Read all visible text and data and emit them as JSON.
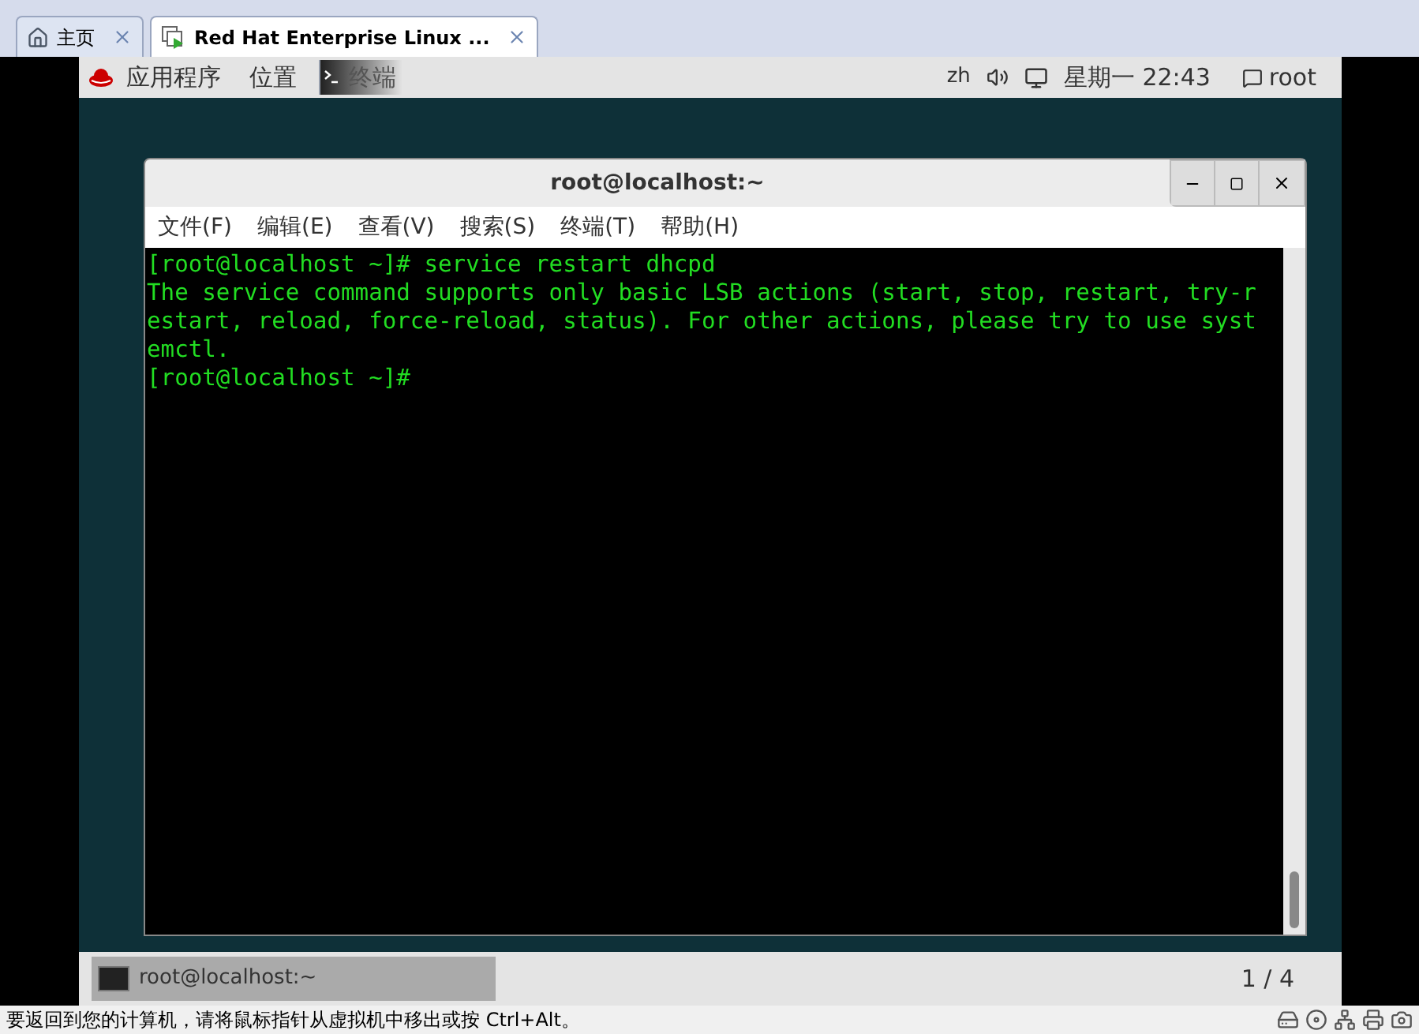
{
  "tabs": [
    {
      "label": "主页",
      "kind": "home",
      "selected": false
    },
    {
      "label": "Red Hat Enterprise Linux ...",
      "kind": "vm",
      "selected": true
    }
  ],
  "top_bar": {
    "menus": [
      "应用程序",
      "位置"
    ],
    "active_app": "终端",
    "input_method": "zh",
    "clock": "星期一 22:43",
    "user": "root"
  },
  "terminal": {
    "title": "root@localhost:~",
    "menu": [
      "文件(F)",
      "编辑(E)",
      "查看(V)",
      "搜索(S)",
      "终端(T)",
      "帮助(H)"
    ],
    "lines": [
      "[root@localhost ~]# service restart dhcpd",
      "The service command supports only basic LSB actions (start, stop, restart, try-r",
      "estart, reload, force-reload, status). For other actions, please try to use syst",
      "emctl.",
      "[root@localhost ~]#"
    ]
  },
  "taskbar": {
    "window": "root@localhost:~",
    "workspace": "1 / 4"
  },
  "status_bar": {
    "message": "要返回到您的计算机，请将鼠标指针从虚拟机中移出或按 Ctrl+Alt。"
  }
}
